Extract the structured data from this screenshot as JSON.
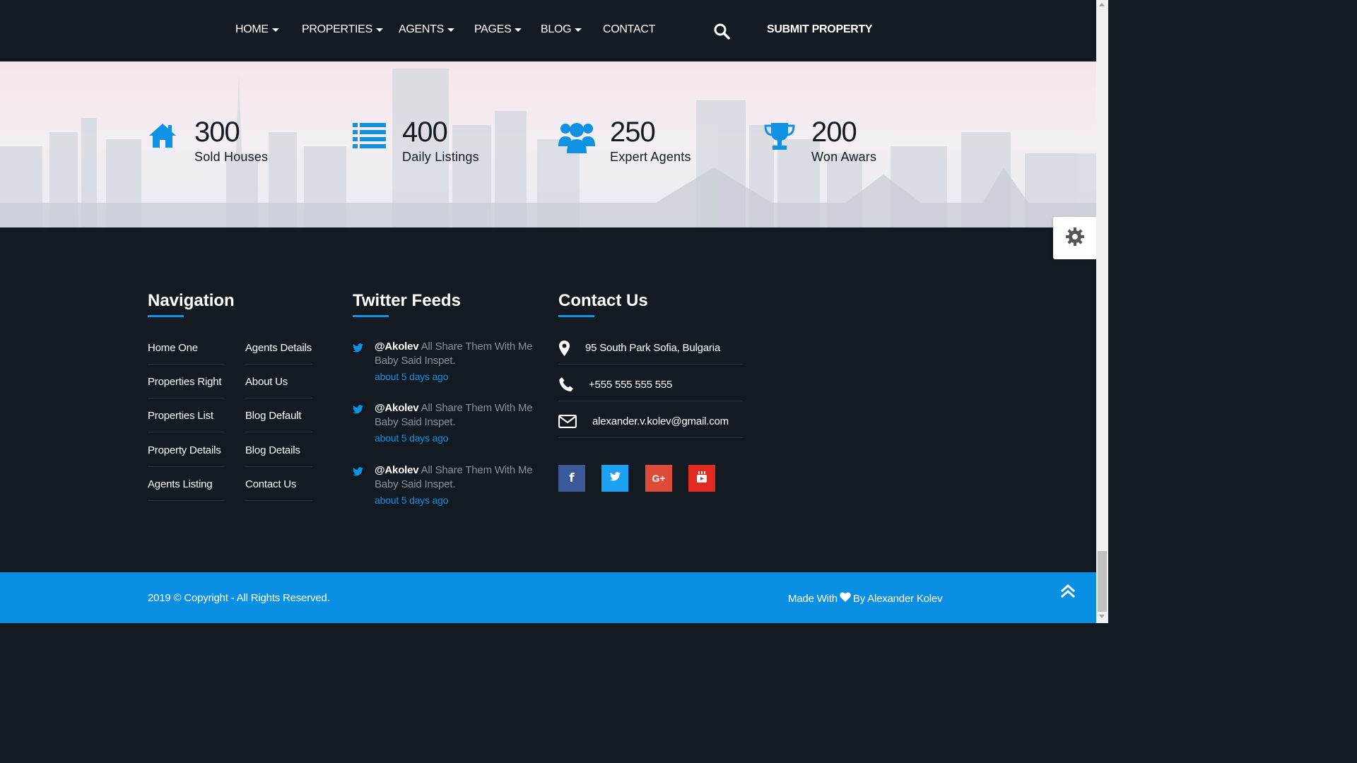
{
  "header": {
    "nav": [
      {
        "label": "HOME",
        "has_dropdown": true
      },
      {
        "label": "PROPERTIES",
        "has_dropdown": true
      },
      {
        "label": "AGENTS",
        "has_dropdown": true
      },
      {
        "label": "PAGES",
        "has_dropdown": true
      },
      {
        "label": "BLOG",
        "has_dropdown": true
      },
      {
        "label": "CONTACT",
        "has_dropdown": false
      }
    ],
    "search_icon": "search-icon",
    "submit_label": "SUBMIT PROPERTY"
  },
  "counters": [
    {
      "value": "300",
      "label": "Sold Houses",
      "icon": "home-icon"
    },
    {
      "value": "400",
      "label": "Daily Listings",
      "icon": "list-icon"
    },
    {
      "value": "250",
      "label": "Expert Agents",
      "icon": "users-icon"
    },
    {
      "value": "200",
      "label": "Won Awars",
      "icon": "trophy-icon"
    }
  ],
  "settings_icon": "gear-icon",
  "footer": {
    "navigation": {
      "title": "Navigation",
      "col1": [
        "Home One",
        "Properties Right",
        "Properties List",
        "Property Details",
        "Agents Listing"
      ],
      "col2": [
        "Agents Details",
        "About Us",
        "Blog Default",
        "Blog Details",
        "Contact Us"
      ]
    },
    "twitter": {
      "title": "Twitter Feeds",
      "tweets": [
        {
          "user": "@Akolev",
          "text": "All Share Them With Me Baby Said Inspet.",
          "time": "about 5 days ago"
        },
        {
          "user": "@Akolev",
          "text": "All Share Them With Me Baby Said Inspet.",
          "time": "about 5 days ago"
        },
        {
          "user": "@Akolev",
          "text": "All Share Them With Me Baby Said Inspet.",
          "time": "about 5 days ago"
        }
      ]
    },
    "contact": {
      "title": "Contact Us",
      "address": "95 South Park Sofia, Bulgaria",
      "phone": "+555 555 555 555",
      "email": "alexander.v.kolev@gmail.com"
    },
    "social": [
      {
        "name": "facebook",
        "glyph": "f",
        "color": "#3b5998"
      },
      {
        "name": "twitter",
        "glyph": "",
        "color": "#1da1f2"
      },
      {
        "name": "google-plus",
        "glyph": "G+",
        "color": "#dd4b39"
      },
      {
        "name": "youtube",
        "glyph": "",
        "color": "#e02a20"
      }
    ]
  },
  "bottom_bar": {
    "copyright": "2019 © Copyright - All Rights Reserved.",
    "made_with": "Made With",
    "by": "By Alexander Kolev"
  },
  "colors": {
    "accent": "#0f92e3",
    "dark": "#131a22",
    "bottom_bar": "#0b8fe3"
  }
}
